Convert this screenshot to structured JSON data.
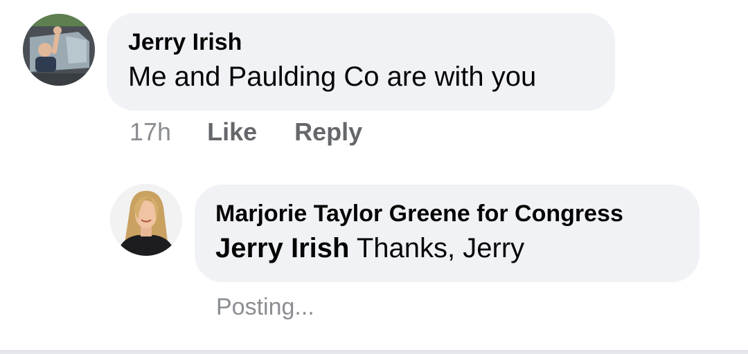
{
  "comments": [
    {
      "author": "Jerry Irish",
      "text": "Me and Paulding Co are with you",
      "timestamp": "17h",
      "actions": {
        "like": "Like",
        "reply": "Reply"
      },
      "avatar": "man-in-car-waving-avatar"
    }
  ],
  "reply": {
    "author": "Marjorie Taylor Greene for Congress",
    "mention": "Jerry Irish",
    "text": " Thanks, Jerry",
    "status": "Posting...",
    "avatar": "woman-portrait-avatar"
  },
  "colors": {
    "bubble": "#f0f2f5",
    "text": "#050505",
    "secondary": "#65676b",
    "muted": "#8a8d91"
  }
}
